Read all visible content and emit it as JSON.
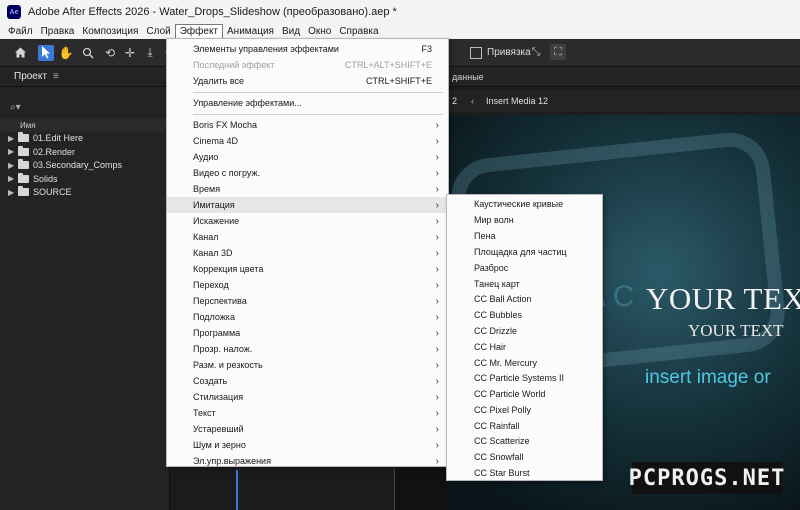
{
  "window": {
    "logo": "Ae",
    "title": "Adobe After Effects 2026 - Water_Drops_Slideshow (преобразовано).aep *"
  },
  "menubar": [
    "Файл",
    "Правка",
    "Композиция",
    "Слой",
    "Эффект",
    "Анимация",
    "Вид",
    "Окно",
    "Справка"
  ],
  "menubar_active": "Эффект",
  "toolbar": {
    "tools": [
      "home-icon",
      "selection-arrow-icon",
      "hand-icon",
      "zoom-icon",
      "orbit-icon",
      "pan-icon",
      "dolly-icon",
      "rotate-icon"
    ],
    "active_tool": "selection-arrow-icon",
    "snap_label": "Привязка",
    "snap_checked": false
  },
  "project_panel": {
    "title": "Проект",
    "search_glyph": "⌕▾",
    "column_header": "Имя",
    "items": [
      {
        "name": "01.Edit Here",
        "type": "folder"
      },
      {
        "name": "02.Render",
        "type": "folder"
      },
      {
        "name": "03.Secondary_Comps",
        "type": "folder"
      },
      {
        "name": "Solids",
        "type": "folder"
      },
      {
        "name": "SOURCE",
        "type": "folder"
      }
    ]
  },
  "right_panel": {
    "header_fragment": "данные",
    "tab_number": "2",
    "tab_label": "Insert Media 12"
  },
  "viewer": {
    "big_text": "YOUR TEX",
    "small_text": "YOUR TEXT",
    "insert_text": "insert image or",
    "faint_letters": "A C"
  },
  "watermark": "PCPROGS.NET",
  "effect_menu": {
    "items": [
      {
        "label": "Элементы управления эффектами",
        "shortcut": "F3",
        "disabled": false
      },
      {
        "label": "Последний эффект",
        "shortcut": "CTRL+ALT+SHIFT+E",
        "disabled": true
      },
      {
        "label": "Удалить все",
        "shortcut": "CTRL+SHIFT+E",
        "disabled": false
      },
      {
        "label": "Управление эффектами...",
        "shortcut": "",
        "disabled": false
      },
      {
        "label": "Boris FX Mocha",
        "submenu": true
      },
      {
        "label": "Cinema 4D",
        "submenu": true
      },
      {
        "label": "Аудио",
        "submenu": true
      },
      {
        "label": "Видео с погруж.",
        "submenu": true
      },
      {
        "label": "Время",
        "submenu": true
      },
      {
        "label": "Имитация",
        "submenu": true,
        "highlighted": true
      },
      {
        "label": "Искажение",
        "submenu": true
      },
      {
        "label": "Канал",
        "submenu": true
      },
      {
        "label": "Канал 3D",
        "submenu": true
      },
      {
        "label": "Коррекция цвета",
        "submenu": true
      },
      {
        "label": "Переход",
        "submenu": true
      },
      {
        "label": "Перспектива",
        "submenu": true
      },
      {
        "label": "Подложка",
        "submenu": true
      },
      {
        "label": "Программа",
        "submenu": true
      },
      {
        "label": "Прозр. налож.",
        "submenu": true
      },
      {
        "label": "Разм. и резкость",
        "submenu": true
      },
      {
        "label": "Создать",
        "submenu": true
      },
      {
        "label": "Стилизация",
        "submenu": true
      },
      {
        "label": "Текст",
        "submenu": true
      },
      {
        "label": "Устаревший",
        "submenu": true
      },
      {
        "label": "Шум и зерно",
        "submenu": true
      },
      {
        "label": "Эл.упр.выражения",
        "submenu": true
      }
    ]
  },
  "simulation_submenu": {
    "items": [
      "Каустические кривые",
      "Мир волн",
      "Пена",
      "Площадка для частиц",
      "Разброс",
      "Танец карт",
      "CC Ball Action",
      "CC Bubbles",
      "CC Drizzle",
      "CC Hair",
      "CC Mr. Mercury",
      "CC Particle Systems II",
      "CC Particle World",
      "CC Pixel Polly",
      "CC Rainfall",
      "CC Scatterize",
      "CC Snowfall",
      "CC Star Burst"
    ]
  }
}
